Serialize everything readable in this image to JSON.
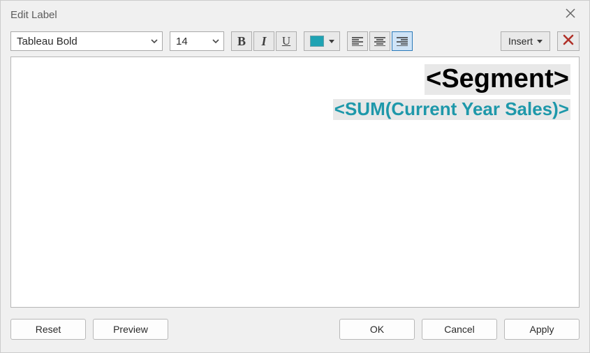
{
  "window": {
    "title": "Edit Label"
  },
  "toolbar": {
    "font_name": "Tableau Bold",
    "font_size": "14",
    "color_swatch_hex": "#1fa3b3",
    "insert_label": "Insert",
    "alignment_selected": "right"
  },
  "editor": {
    "lines": [
      {
        "text": "<Segment>",
        "style": "segment"
      },
      {
        "text": "<SUM(Current Year Sales)>",
        "style": "sum"
      }
    ],
    "line1_text": "<Segment>",
    "line2_text": "<SUM(Current Year Sales)>"
  },
  "buttons": {
    "reset": "Reset",
    "preview": "Preview",
    "ok": "OK",
    "cancel": "Cancel",
    "apply": "Apply"
  }
}
